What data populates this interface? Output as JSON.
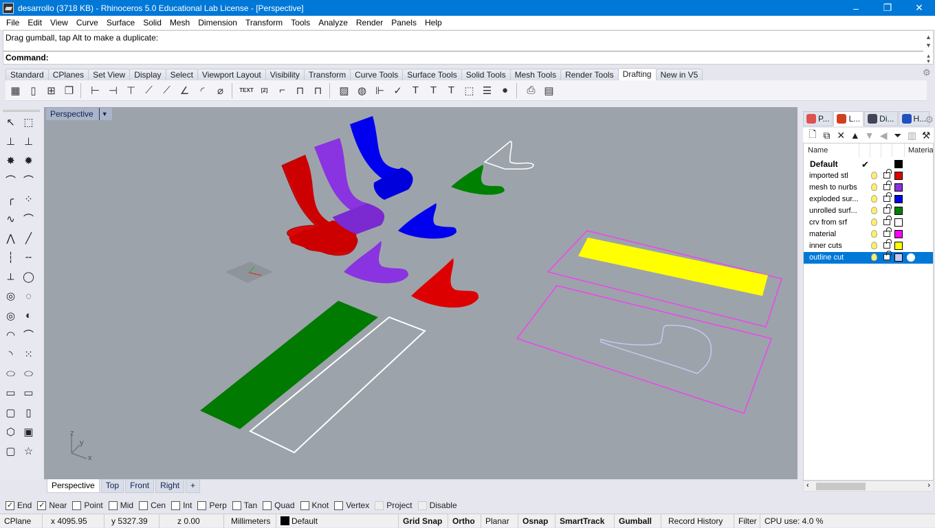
{
  "window": {
    "title": "desarrollo (3718 KB) - Rhinoceros 5.0 Educational Lab License - [Perspective]",
    "controls": {
      "minimize": "–",
      "restore": "❐",
      "close": "✕"
    }
  },
  "menu": [
    "File",
    "Edit",
    "View",
    "Curve",
    "Surface",
    "Solid",
    "Mesh",
    "Dimension",
    "Transform",
    "Tools",
    "Analyze",
    "Render",
    "Panels",
    "Help"
  ],
  "command": {
    "history": "Drag gumball, tap Alt to make a duplicate:",
    "label": "Command:",
    "value": ""
  },
  "toolbar_tabs": [
    {
      "label": "Standard"
    },
    {
      "label": "CPlanes"
    },
    {
      "label": "Set View"
    },
    {
      "label": "Display"
    },
    {
      "label": "Select"
    },
    {
      "label": "Viewport Layout"
    },
    {
      "label": "Visibility"
    },
    {
      "label": "Transform"
    },
    {
      "label": "Curve Tools"
    },
    {
      "label": "Surface Tools"
    },
    {
      "label": "Solid Tools"
    },
    {
      "label": "Mesh Tools"
    },
    {
      "label": "Render Tools"
    },
    {
      "label": "Drafting",
      "active": true
    },
    {
      "label": "New in V5"
    }
  ],
  "toolbar_icons": [
    "layout-icon",
    "new-page-icon",
    "add-page-icon",
    "page-copy-icon",
    "sep",
    "dim-linear-icon",
    "dim-aligned-icon",
    "dim-horizontal-icon",
    "dim-rotated-icon",
    "dim-angled-icon",
    "dim-angle-icon",
    "dim-radius-icon",
    "dim-diameter-icon",
    "sep",
    "text-icon",
    "leader-icon",
    "leader2-icon",
    "dim-baseline-icon",
    "dim-chain-icon",
    "sep",
    "hatch-icon",
    "hatch-edit-icon",
    "dim-edit-icon",
    "dim-check-icon",
    "text-edit-icon",
    "text-find-icon",
    "text-style-icon",
    "make2d-icon",
    "annotation-style-icon",
    "sphere-render-icon",
    "sep",
    "print-icon",
    "layer-delete-icon"
  ],
  "toolbar_icon_text": {
    "text-icon": "TEXT",
    "leader-icon": "[2]"
  },
  "viewport": {
    "title": "Perspective",
    "axes": {
      "x": "x",
      "y": "y",
      "z": "z"
    }
  },
  "viewport_tabs": [
    {
      "label": "Perspective",
      "active": true
    },
    {
      "label": "Top"
    },
    {
      "label": "Front"
    },
    {
      "label": "Right"
    },
    {
      "label": "+"
    }
  ],
  "panel": {
    "tabs": [
      {
        "label": "P...",
        "icon": "properties-icon",
        "color": "#e05050"
      },
      {
        "label": "L...",
        "icon": "layers-icon",
        "color": "#d04020",
        "active": true
      },
      {
        "label": "Di...",
        "icon": "display-icon",
        "color": "#445"
      },
      {
        "label": "H...",
        "icon": "help-icon",
        "color": "#2050c0"
      }
    ],
    "toolbar": [
      "new-layer-icon",
      "new-sublayer-icon",
      "delete-icon",
      "move-up-icon",
      "move-down-icon",
      "move-out-icon",
      "filter-icon",
      "trash-icon",
      "tools-icon"
    ],
    "columns": {
      "name": "Name",
      "material": "Material"
    },
    "layers": [
      {
        "name": "Default",
        "color": "#000000",
        "current": true,
        "bold": true
      },
      {
        "name": "imported stl",
        "color": "#e00000"
      },
      {
        "name": "mesh to nurbs",
        "color": "#8833dd"
      },
      {
        "name": "exploded sur...",
        "color": "#0000ee"
      },
      {
        "name": "unrolled surf...",
        "color": "#008000"
      },
      {
        "name": "crv from srf",
        "color": "#ffffff"
      },
      {
        "name": "material",
        "color": "#ff00ff"
      },
      {
        "name": "inner cuts",
        "color": "#ffff00"
      },
      {
        "name": "outline cut",
        "color": "#c8c8f0",
        "selected": true
      }
    ]
  },
  "osnaps": [
    {
      "label": "End",
      "checked": true
    },
    {
      "label": "Near",
      "checked": true
    },
    {
      "label": "Point",
      "checked": false
    },
    {
      "label": "Mid",
      "checked": false
    },
    {
      "label": "Cen",
      "checked": false
    },
    {
      "label": "Int",
      "checked": false
    },
    {
      "label": "Perp",
      "checked": false
    },
    {
      "label": "Tan",
      "checked": false
    },
    {
      "label": "Quad",
      "checked": false
    },
    {
      "label": "Knot",
      "checked": false
    },
    {
      "label": "Vertex",
      "checked": false
    },
    {
      "label": "Project",
      "checked": false,
      "disabled": true
    },
    {
      "label": "Disable",
      "checked": false,
      "disabled": true
    }
  ],
  "status": {
    "cplane": "CPlane",
    "x": "x 4095.95",
    "y": "y 5327.39",
    "z": "z 0.00",
    "units": "Millimeters",
    "layer": "Default",
    "grid_snap": "Grid Snap",
    "ortho": "Ortho",
    "planar": "Planar",
    "osnap": "Osnap",
    "smarttrack": "SmartTrack",
    "gumball": "Gumball",
    "record_history": "Record History",
    "filter": "Filter",
    "cpu": "CPU use: 4.0 %"
  },
  "scene_colors": {
    "red": "#e00000",
    "purple": "#8a33e0",
    "blue": "#0000ee",
    "green": "#007a00",
    "white": "#ffffff",
    "magenta": "#ee44ee",
    "yellow": "#ffff00",
    "lavender": "#c8c8f0"
  }
}
